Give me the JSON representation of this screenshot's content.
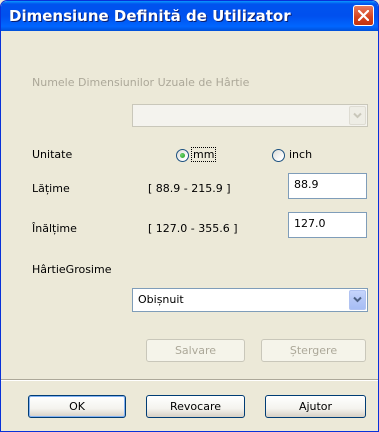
{
  "window": {
    "title": "Dimensiune Definită de Utilizator"
  },
  "paper_sizes": {
    "label": "Numele Dimensiunilor Uzuale de Hârtie",
    "value": ""
  },
  "unit": {
    "label": "Unitate",
    "options": [
      "mm",
      "inch"
    ],
    "selected": "mm"
  },
  "width": {
    "label": "Lățime",
    "range": "[ 88.9 - 215.9 ]",
    "value": "88.9"
  },
  "height": {
    "label": "Înălțime",
    "range": "[ 127.0 - 355.6 ]",
    "value": "127.0"
  },
  "thickness": {
    "label": "HârtieGrosime",
    "value": "Obișnuit"
  },
  "actions": {
    "save": "Salvare",
    "delete": "Ștergere"
  },
  "footer": {
    "ok": "OK",
    "cancel": "Revocare",
    "help": "Ajutor"
  },
  "colors": {
    "titlebar": "#0053ee",
    "close": "#d5421d",
    "dialog_bg": "#ece9d8",
    "disabled_text": "#aca899"
  }
}
